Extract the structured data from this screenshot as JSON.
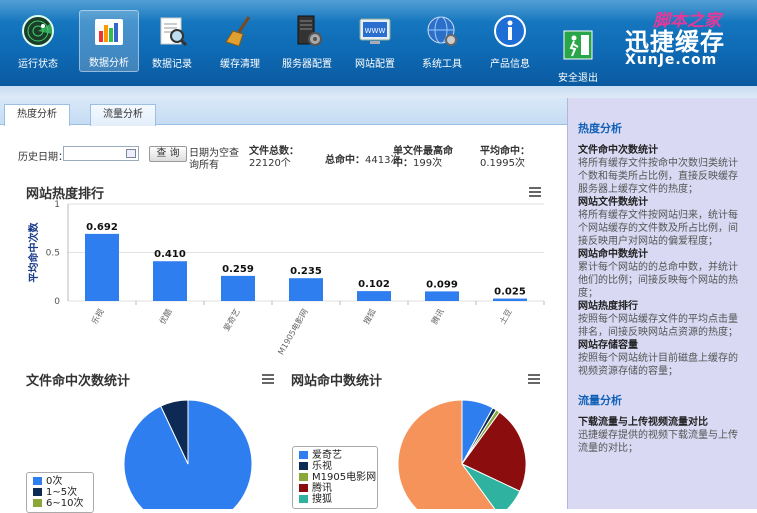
{
  "nav": {
    "items": [
      {
        "label": "运行状态",
        "icon": "radar-icon"
      },
      {
        "label": "数据分析",
        "icon": "bar-chart-icon",
        "active": true
      },
      {
        "label": "数据记录",
        "icon": "document-search-icon"
      },
      {
        "label": "缓存清理",
        "icon": "broom-icon"
      },
      {
        "label": "服务器配置",
        "icon": "server-gear-icon"
      },
      {
        "label": "网站配置",
        "icon": "www-monitor-icon"
      },
      {
        "label": "系统工具",
        "icon": "globe-gear-icon"
      },
      {
        "label": "产品信息",
        "icon": "info-icon"
      },
      {
        "label": "安全退出",
        "icon": "exit-door-icon"
      }
    ],
    "logo_cn": "迅捷缓存",
    "logo_en": "XunJe.com",
    "watermark": "脚本之家"
  },
  "tabs": [
    {
      "label": "热度分析",
      "active": true
    },
    {
      "label": "流量分析",
      "active": false
    }
  ],
  "filter": {
    "history_label": "历史日期：",
    "date_value": "",
    "query_button": "查 询",
    "hint": "日期为空查询所有"
  },
  "stats": {
    "file_total_label": "文件总数：",
    "file_total_value": "22120个",
    "hit_total_label": "总命中：",
    "hit_total_value": "4413次",
    "single_max_label": "单文件最高命中：",
    "single_max_value": "199次",
    "avg_label": "平均命中：",
    "avg_value": "0.1995次"
  },
  "chart_data": [
    {
      "type": "bar",
      "title": "网站热度排行",
      "ylabel": "平均命中次数",
      "ylim": [
        0,
        1
      ],
      "yticks": [
        0,
        0.5,
        1
      ],
      "categories": [
        "乐视",
        "优酷",
        "爱奇艺",
        "M1905电影网",
        "搜狐",
        "腾讯",
        "土豆"
      ],
      "values": [
        0.692,
        0.41,
        0.259,
        0.235,
        0.102,
        0.099,
        0.025
      ],
      "color": "#2e7ef0"
    },
    {
      "type": "pie",
      "title": "文件命中次数统计",
      "legend": [
        "0次",
        "1~5次",
        "6~10次"
      ],
      "colors": [
        "#2e7ef0",
        "#0d2a55",
        "#8aa73a"
      ],
      "values": [
        93,
        7,
        0
      ]
    },
    {
      "type": "pie",
      "title": "网站命中数统计",
      "legend": [
        "爱奇艺",
        "乐视",
        "M1905电影网",
        "腾讯",
        "搜狐"
      ],
      "colors": [
        "#2e7ef0",
        "#0d2a55",
        "#8aa73a",
        "#8b0d0d",
        "#2fb3a0",
        "#f5935a"
      ],
      "values": [
        8,
        1,
        1,
        22,
        8,
        60
      ]
    }
  ],
  "sidebar": {
    "heading1": "热度分析",
    "items": [
      {
        "title": "文件命中次数统计",
        "desc": "将所有缓存文件按命中次数归类统计个数和每类所占比例，直接反映缓存服务器上缓存文件的热度；"
      },
      {
        "title": "网站文件数统计",
        "desc": "将所有缓存文件按网站归来，统计每个网站缓存的文件数及所占比例，间接反映用户对网站的偏爱程度；"
      },
      {
        "title": "网站命中数统计",
        "desc": "累计每个网站的的总命中数，并统计他们的比例；间接反映每个网站的热度；"
      },
      {
        "title": "网站热度排行",
        "desc": "按照每个网站缓存文件的平均点击量排名，间接反映网站点资源的热度；"
      },
      {
        "title": "网站存储容量",
        "desc": "按照每个网站统计目前磁盘上缓存的视频资源存储的容量；"
      }
    ],
    "heading2": "流量分析",
    "items2": [
      {
        "title": "下载流量与上传视频流量对比",
        "desc": "迅捷缓存提供的视频下载流量与上传流量的对比；"
      }
    ]
  }
}
